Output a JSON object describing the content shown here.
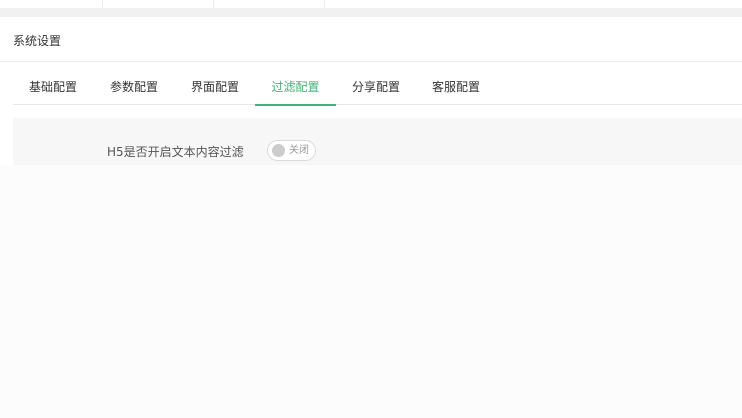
{
  "header": {
    "title": "系统设置"
  },
  "tabs": [
    {
      "label": "基础配置",
      "active": false
    },
    {
      "label": "参数配置",
      "active": false
    },
    {
      "label": "界面配置",
      "active": false
    },
    {
      "label": "过滤配置",
      "active": true
    },
    {
      "label": "分享配置",
      "active": false
    },
    {
      "label": "客服配置",
      "active": false
    }
  ],
  "form": {
    "h5_filter_label": "H5是否开启文本内容过滤",
    "h5_filter_switch": {
      "state": "off",
      "text": "关闭"
    }
  },
  "colors": {
    "accent": "#3eb475"
  }
}
